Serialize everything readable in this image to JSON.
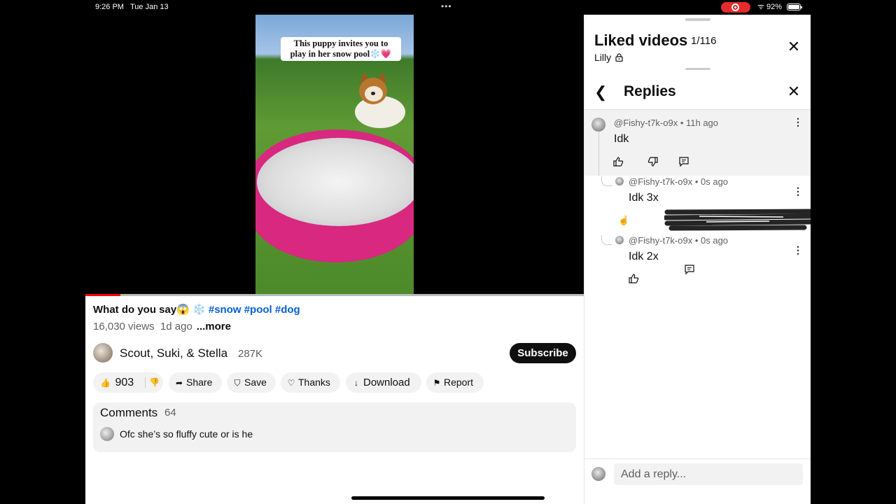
{
  "status_bar": {
    "time": "9:26 PM",
    "date": "Tue Jan 13",
    "battery": "92%"
  },
  "video": {
    "caption_line1": "This puppy invites you to",
    "caption_line2": "play in her snow pool❄️💗",
    "progress_fraction": 0.07
  },
  "meta": {
    "title_text": "What do you say😱 ❄️ ",
    "hashtags": "#snow #pool #dog",
    "views": "16,030 views",
    "age": "1d ago",
    "more_label": "...more"
  },
  "channel": {
    "name": "Scout, Suki, & Stella",
    "subscribers": "287K",
    "subscribe_label": "Subscribe"
  },
  "actions": {
    "like_count": "903",
    "share_label": "Share",
    "save_label": "Save",
    "thanks_label": "Thanks",
    "download_label": "Download",
    "report_label": "Report"
  },
  "comments": {
    "heading": "Comments",
    "count": "64",
    "preview_text": "Ofc she’s so fluffy cute or is he"
  },
  "panel": {
    "title": "Liked videos",
    "count": "1/116",
    "owner": "Lilly",
    "replies_title": "Replies",
    "parent": {
      "author": "@Fishy-t7k-o9x • 11h ago",
      "text": "Idk"
    },
    "replies": [
      {
        "author": "@Fishy-t7k-o9x • 0s ago",
        "text": "Idk 3x"
      },
      {
        "author": "@Fishy-t7k-o9x • 0s ago",
        "text": "Idk 2x"
      }
    ],
    "reply_placeholder": "Add a reply..."
  },
  "colors": {
    "accent_link": "#065fd4",
    "record_red": "#e52b2b",
    "progress_red": "#ff0000",
    "pool_pink": "#d8287f"
  }
}
